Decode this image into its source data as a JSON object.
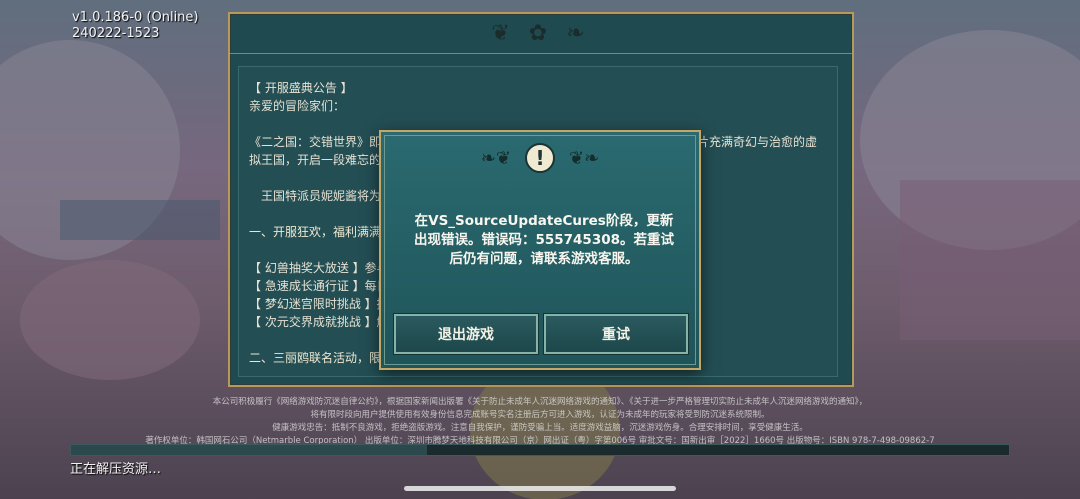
{
  "version": {
    "line1": "v1.0.186-0 (Online)",
    "line2": "240222-1523"
  },
  "notice": {
    "title": "【 开服盛典公告 】",
    "greeting": "亲爱的冒险家们：",
    "para1_line1": "《二之国：交错世界》即将于2024年2月29日上午10:00盛大开启，邀您一同踏上这片充满奇幻与治愈的虚",
    "para1_line2": "拟王国，开启一段难忘的冒险之旅吧！",
    "para2": "王国特派员妮妮酱将为您带来开服庆典的四大福利活动：",
    "section1": "一、开服狂欢，福利满满",
    "items": [
      "【 幻兽抽奖大放送 】参与活动，赢取稀有幻兽！",
      "【 急速成长通行证 】每日登录，轻松获得丰厚奖励！",
      "【 梦幻迷宫限时挑战 】挑战梦幻迷宫关卡，赢取专属好礼！",
      "【 次元交界成就挑战 】解锁全新成就，领取丰厚的奖励！"
    ],
    "section2": "二、三丽鸥联名活动，限时开启"
  },
  "legal": {
    "line1": "本公司积极履行《网络游戏防沉迷自律公约》，根据国家新闻出版署《关于防止未成年人沉迷网络游戏的通知》、《关于进一步严格管理切实防止未成年人沉迷网络游戏的通知》，",
    "line2": "将有限时段向用户提供使用有效身份信息完成账号实名注册后方可进入游戏，认证为未成年的玩家将受到防沉迷系统限制。",
    "line3": "健康游戏忠告：抵制不良游戏，拒绝盗版游戏。注意自我保护，谨防受骗上当。适度游戏益脑，沉迷游戏伤身。合理安排时间，享受健康生活。",
    "line4": "著作权单位：韩国网石公司（Netmarble Corporation） 出版单位：深圳市腾梦天地科技有限公司（京）网出证（粤）字第006号 审批文号：国新出审［2022］1660号 出版物号：ISBN 978-7-498-09862-7"
  },
  "progress": {
    "percent": 0.38
  },
  "loading_text": "正在解压资源…",
  "dialog": {
    "icon": "exclamation-icon",
    "icon_glyph": "!",
    "message": "在VS_SourceUpdateCures阶段，更新出现错误。错误码：555745308。若重试后仍有问题，请联系游戏客服。",
    "exit_label": "退出游戏",
    "retry_label": "重试"
  },
  "colors": {
    "panel": "#1f4a4f",
    "gold_border": "#c4a765",
    "button_border": "#86b2a8"
  }
}
